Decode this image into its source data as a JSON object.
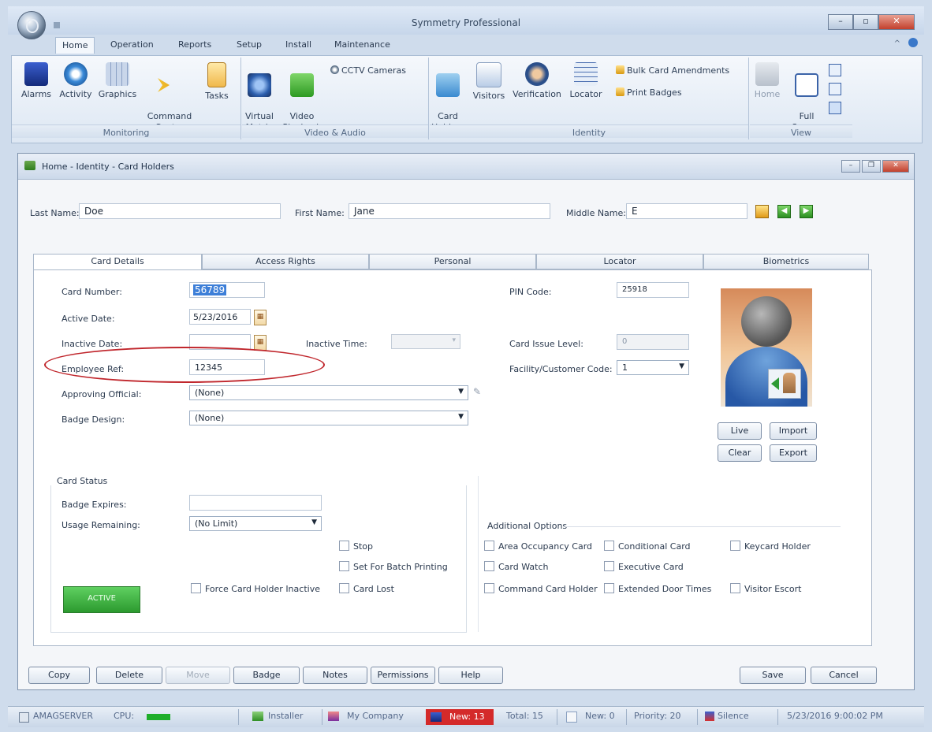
{
  "app": {
    "title": "Symmetry Professional"
  },
  "ribbon": {
    "tabs": [
      "Home",
      "Operation",
      "Reports",
      "Setup",
      "Install",
      "Maintenance"
    ],
    "groups": {
      "monitoring": {
        "label": "Monitoring",
        "buttons": [
          "Alarms",
          "Activity",
          "Graphics",
          "Command\nCenter",
          "Tasks"
        ]
      },
      "video": {
        "label": "Video & Audio",
        "buttons": [
          "Virtual\nMatrix",
          "Video\nPlayback"
        ],
        "small": "CCTV Cameras"
      },
      "identity": {
        "label": "Identity",
        "buttons": [
          "Card\nHolders",
          "Visitors",
          "Verification",
          "Locator"
        ],
        "small": [
          "Bulk Card Amendments",
          "Print Badges"
        ]
      },
      "view": {
        "label": "View",
        "buttons": [
          "Home",
          "Full\nScreen"
        ]
      }
    }
  },
  "window": {
    "title": "Home - Identity - Card Holders"
  },
  "names": {
    "last_label": "Last Name:",
    "last_value": "Doe",
    "first_label": "First Name:",
    "first_value": "Jane",
    "middle_label": "Middle Name:",
    "middle_value": "E"
  },
  "tabs": [
    "Card Details",
    "Access Rights",
    "Personal",
    "Locator",
    "Biometrics"
  ],
  "card": {
    "card_number_label": "Card Number:",
    "card_number": "56789",
    "active_date_label": "Active Date:",
    "active_date": "5/23/2016",
    "inactive_date_label": "Inactive Date:",
    "inactive_date": "",
    "inactive_time_label": "Inactive Time:",
    "employee_ref_label": "Employee Ref:",
    "employee_ref": "12345",
    "approving_label": "Approving Official:",
    "approving": "(None)",
    "badge_label": "Badge Design:",
    "badge": "(None)",
    "pin_label": "PIN Code:",
    "pin": "25918",
    "issue_label": "Card Issue Level:",
    "issue": "0",
    "facility_label": "Facility/Customer Code:",
    "facility": "1"
  },
  "photo_buttons": [
    "Live",
    "Import",
    "Clear",
    "Export"
  ],
  "status": {
    "title": "Card Status",
    "badge_expires_label": "Badge Expires:",
    "badge_expires": "",
    "usage_label": "Usage Remaining:",
    "usage": "(No Limit)",
    "force_inactive": "Force Card Holder Inactive",
    "stop": "Stop",
    "batch": "Set For Batch Printing",
    "lost": "Card Lost",
    "active_button": "ACTIVE"
  },
  "additional": {
    "title": "Additional Options",
    "options": [
      "Area Occupancy Card",
      "Conditional Card",
      "Keycard Holder",
      "Card Watch",
      "Executive Card",
      "Command Card Holder",
      "Extended Door Times",
      "Visitor Escort"
    ]
  },
  "footer_buttons": {
    "copy": "Copy",
    "delete": "Delete",
    "move": "Move",
    "badge": "Badge",
    "notes": "Notes",
    "permissions": "Permissions",
    "help": "Help",
    "save": "Save",
    "cancel": "Cancel"
  },
  "statusbar": {
    "server": "AMAGSERVER",
    "cpu": "CPU:",
    "installer": "Installer",
    "company": "My Company",
    "new_alarms": "New: 13",
    "total": "Total: 15",
    "new": "New: 0",
    "priority": "Priority: 20",
    "silence": "Silence",
    "datetime": "5/23/2016 9:00:02 PM"
  },
  "colors": {
    "active_green": "#2c9a2f",
    "alarm_red": "#d42a2a",
    "highlight_oval": "#c0262c",
    "selection": "#3d7fd8"
  }
}
